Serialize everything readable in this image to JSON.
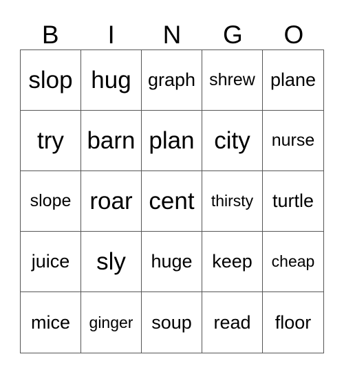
{
  "header": [
    "B",
    "I",
    "N",
    "G",
    "O"
  ],
  "cells": [
    "slop",
    "hug",
    "graph",
    "shrew",
    "plane",
    "try",
    "barn",
    "plan",
    "city",
    "nurse",
    "slope",
    "roar",
    "cent",
    "thirsty",
    "turtle",
    "juice",
    "sly",
    "huge",
    "keep",
    "cheap",
    "mice",
    "ginger",
    "soup",
    "read",
    "floor"
  ]
}
